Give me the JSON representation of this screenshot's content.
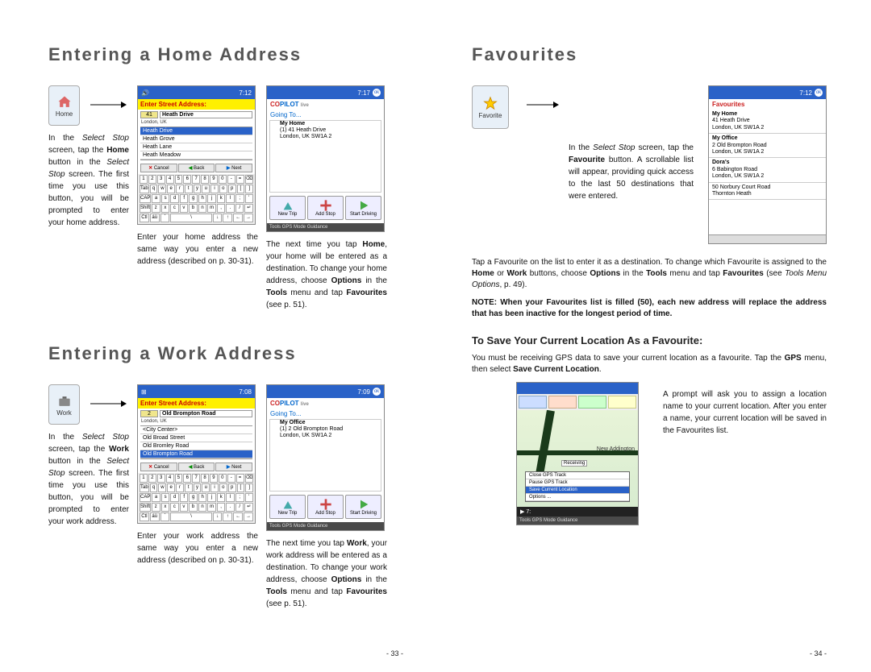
{
  "left": {
    "h1a": "Entering a Home Address",
    "h1b": "Entering a Work Address",
    "home": {
      "iconLabel": "Home",
      "caption": "In the Select Stop screen, tap the Home button in the Select Stop screen. The first time you use this button, you will be prompted to enter your home address.",
      "dev1": {
        "time": "7:12",
        "header": "Enter Street Address:",
        "num": "41",
        "street": "Heath Drive",
        "city": "London, UK",
        "list": [
          "Heath Drive",
          "Heath Grove",
          "Heath Lane",
          "Heath Meadow"
        ],
        "btns": [
          "Cancel",
          "Back",
          "Next"
        ],
        "cap": "Enter your home address the same way you enter a new address (described on p. 30-31)."
      },
      "dev2": {
        "time": "7:17",
        "logo": "COPILOT live",
        "going": "Going To...",
        "addr": [
          "My Home",
          "(1)  41 Heath Drive",
          "London, UK SW1A 2"
        ],
        "btns": [
          "New Trip",
          "Add Stop",
          "Start Driving"
        ],
        "menu": "Tools  GPS  Mode  Guidance",
        "cap": "The next time you tap Home, your home will be entered as a destination. To change your home address, choose Options in the Tools menu and tap Favourites (see p. 51)."
      }
    },
    "work": {
      "iconLabel": "Work",
      "caption": "In the Select Stop screen, tap the Work button in the Select Stop screen. The first time you use this button, you will be prompted to enter your work address.",
      "dev1": {
        "time": "7:08",
        "header": "Enter Street Address:",
        "num": "2",
        "street": "Old Brompton Road",
        "city": "London, UK",
        "list": [
          "<City Center>",
          "Old Broad Street",
          "Old Bromley Road",
          "Old Brompton Road"
        ],
        "btns": [
          "Cancel",
          "Back",
          "Next"
        ],
        "cap": "Enter your work address the same way you enter a new address (described on p. 30-31)."
      },
      "dev2": {
        "time": "7:09",
        "logo": "COPILOT live",
        "going": "Going To...",
        "addr": [
          "My Office",
          "(1)  2 Old Brompton Road",
          "London, UK SW1A 2"
        ],
        "btns": [
          "New Trip",
          "Add Stop",
          "Start Driving"
        ],
        "menu": "Tools  GPS  Mode  Guidance",
        "cap": "The next time you tap Work, your work address will be entered as a destination. To change your work address, choose Options in the Tools menu and tap Favourites (see p. 51)."
      }
    },
    "pagenum": "- 33 -"
  },
  "right": {
    "h1": "Favourites",
    "iconLabel": "Favorite",
    "caption1": "In the Select Stop screen, tap the Favourite button. A scrollable list will appear, providing quick access to the last 50 destinations that were entered.",
    "favdev": {
      "time": "7:12",
      "title": "Favourites",
      "items": [
        {
          "t": "My Home",
          "a": "41 Heath Drive",
          "c": "London, UK SW1A 2"
        },
        {
          "t": "My Office",
          "a": "2 Old Brompton Road",
          "c": "London, UK SW1A 2"
        },
        {
          "t": "Dora's",
          "a": "6 Babington Road",
          "c": "London, UK SW1A 2"
        },
        {
          "t": "",
          "a": "50 Norbury Court Road",
          "c": "Thornton Heath"
        }
      ]
    },
    "body1": "Tap a Favourite on the list to enter it as a destination. To change which Favourite is assigned to the Home or Work buttons, choose Options in the Tools menu and tap Favourites (see Tools Menu Options, p. 49).",
    "note": "NOTE: When your Favourites list is filled (50), each new address will replace the address that has been inactive for the longest period of time.",
    "h2": "To Save Your Current Location As a Favourite:",
    "body2": "You must be receiving GPS data to save your current location as a favourite. Tap the GPS menu, then select Save Current Location.",
    "mapdev": {
      "labels": [
        "New Addington"
      ],
      "rec": "Receiving",
      "menu": [
        "Close GPS Track",
        "Pause GPS Track",
        "Save Current Location",
        "Options ..."
      ],
      "menubar": "Tools  GPS  Mode  Guidance"
    },
    "caption2": "A prompt will ask you to assign a location name to your current location. After you enter a name, your current location will be saved in the Favourites list.",
    "pagenum": "- 34 -"
  }
}
